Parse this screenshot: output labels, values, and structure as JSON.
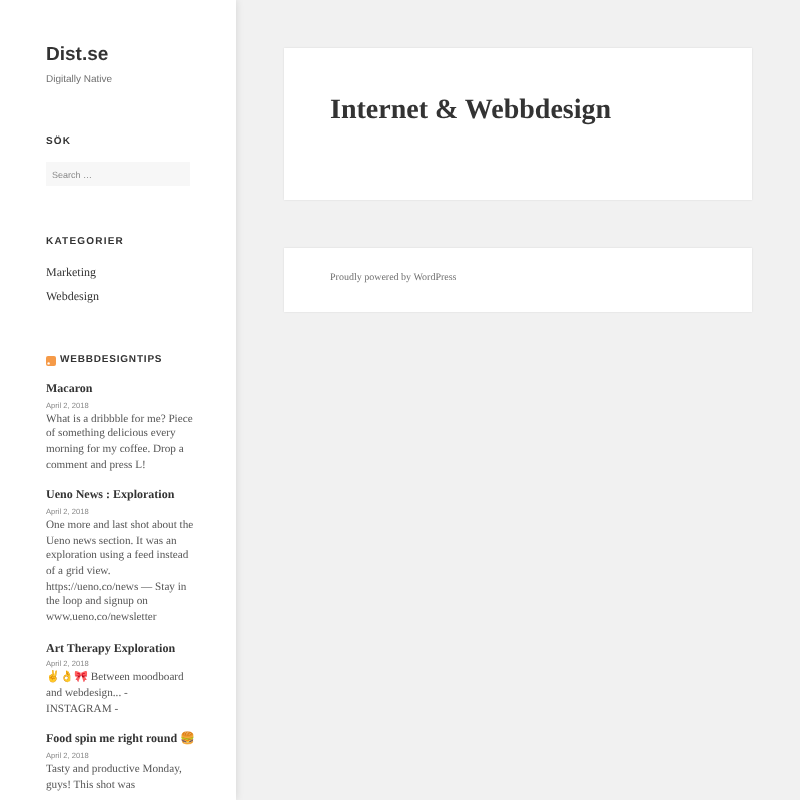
{
  "site": {
    "title": "Dist.se",
    "tagline": "Digitally Native"
  },
  "search": {
    "heading": "SÖK",
    "placeholder": "Search …"
  },
  "categories": {
    "heading": "KATEGORIER",
    "items": [
      "Marketing",
      "Webdesign"
    ]
  },
  "feed": {
    "heading": "WEBBDESIGNTIPS",
    "items": [
      {
        "title": "Macaron",
        "date": "April 2, 2018",
        "excerpt": "What is a dribbble for me? Piece of something delicious every morning for my coffee. Drop a comment and press L!"
      },
      {
        "title": "Ueno News : Exploration",
        "date": "April 2, 2018",
        "excerpt": "One more and last shot about the Ueno news section. It was an exploration using a feed instead of a grid view. https://ueno.co/news — Stay in the loop and signup on www.ueno.co/newsletter"
      },
      {
        "title": "Art Therapy Exploration",
        "date": "April 2, 2018",
        "excerpt": "✌️👌🎀 Between moodboard and webdesign... - INSTAGRAM -"
      },
      {
        "title": "Food spin me right round 🍔",
        "date": "April 2, 2018",
        "excerpt": "Tasty and productive Monday, guys! This shot was"
      }
    ]
  },
  "page": {
    "title": "Internet & Webbdesign"
  },
  "footer": {
    "text": "Proudly powered by WordPress"
  }
}
